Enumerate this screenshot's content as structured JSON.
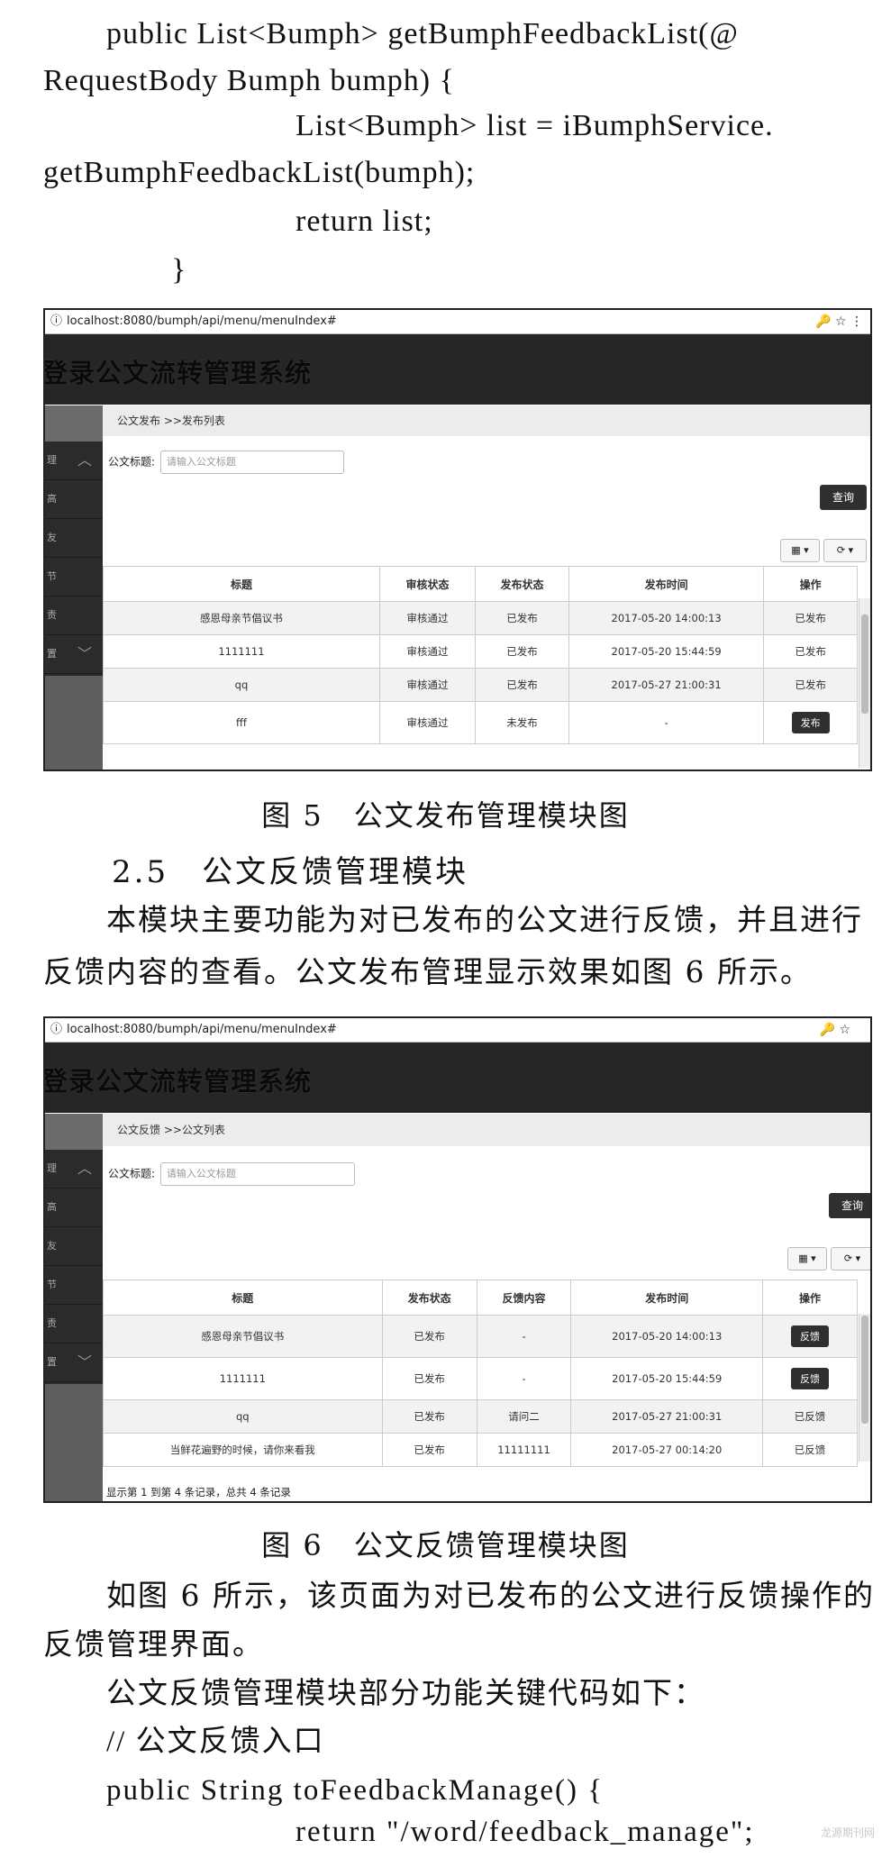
{
  "code_top": [
    "public List<Bumph> getBumphFeedbackList(@",
    "RequestBody Bumph bumph) {",
    "List<Bumph> list = iBumphService.",
    "getBumphFeedbackList(bumph);",
    "return list;",
    "}"
  ],
  "fig5": {
    "url_info_icon": "ⓘ",
    "url": "localhost:8080/bumph/api/menu/menuIndex#",
    "url_icons": "🔑 ☆ ⋮",
    "app_title": "登录公文流转管理系统",
    "sidebar_items": [
      "理",
      "高",
      "友",
      "节",
      "责",
      "置"
    ],
    "breadcrumb": "公文发布 >>发布列表",
    "search_label": "公文标题:",
    "search_placeholder": "请输入公文标题",
    "query_button": "查询",
    "tool1": "▦ ▾",
    "tool2": "⟳ ▾",
    "columns": [
      "标题",
      "审核状态",
      "发布状态",
      "发布时间",
      "操作"
    ],
    "rows": [
      {
        "title": "感恩母亲节倡议书",
        "audit": "审核通过",
        "status": "已发布",
        "time": "2017-05-20 14:00:13",
        "op": "已发布"
      },
      {
        "title": "1111111",
        "audit": "审核通过",
        "status": "已发布",
        "time": "2017-05-20 15:44:59",
        "op": "已发布"
      },
      {
        "title": "qq",
        "audit": "审核通过",
        "status": "已发布",
        "time": "2017-05-27 21:00:31",
        "op": "已发布"
      },
      {
        "title": "fff",
        "audit": "审核通过",
        "status": "未发布",
        "time": "-",
        "op": "发布"
      }
    ],
    "caption": "图 5　公文发布管理模块图"
  },
  "section": {
    "heading": "2.5　公文反馈管理模块",
    "para1_line1": "本模块主要功能为对已发布的公文进行反馈，并且进行",
    "para1_line2": "反馈内容的查看。公文发布管理显示效果如图 6 所示。"
  },
  "fig6": {
    "url_info_icon": "ⓘ",
    "url": "localhost:8080/bumph/api/menu/menuIndex#",
    "url_icons": "🔑 ☆",
    "app_title": "登录公文流转管理系统",
    "sidebar_items": [
      "理",
      "高",
      "友",
      "节",
      "责",
      "置"
    ],
    "breadcrumb": "公文反馈 >>公文列表",
    "search_label": "公文标题:",
    "search_placeholder": "请输入公文标题",
    "query_button": "查询",
    "tool1": "▦ ▾",
    "tool2": "⟳ ▾",
    "columns": [
      "标题",
      "发布状态",
      "反馈内容",
      "发布时间",
      "操作"
    ],
    "rows": [
      {
        "title": "感恩母亲节倡议书",
        "status": "已发布",
        "feedback": "-",
        "time": "2017-05-20 14:00:13",
        "op": "反馈"
      },
      {
        "title": "1111111",
        "status": "已发布",
        "feedback": "-",
        "time": "2017-05-20 15:44:59",
        "op": "反馈"
      },
      {
        "title": "qq",
        "status": "已发布",
        "feedback": "请问二",
        "time": "2017-05-27 21:00:31",
        "op": "已反馈"
      },
      {
        "title": "当鲜花遍野的时候，请你来看我",
        "status": "已发布",
        "feedback": "11111111",
        "time": "2017-05-27 00:14:20",
        "op": "已反馈"
      }
    ],
    "footer": "显示第 1 到第 4 条记录，总共 4 条记录",
    "caption": "图 6　公文反馈管理模块图"
  },
  "after": {
    "para2_line1": "如图 6 所示，该页面为对已发布的公文进行反馈操作的",
    "para2_line2": "反馈管理界面。",
    "para3": "公文反馈管理模块部分功能关键代码如下：",
    "comment": "// 公文反馈入口",
    "code1": "public String toFeedbackManage() {",
    "code2": "return \"/word/feedback_manage\";"
  },
  "watermark": "龙源期刊网"
}
